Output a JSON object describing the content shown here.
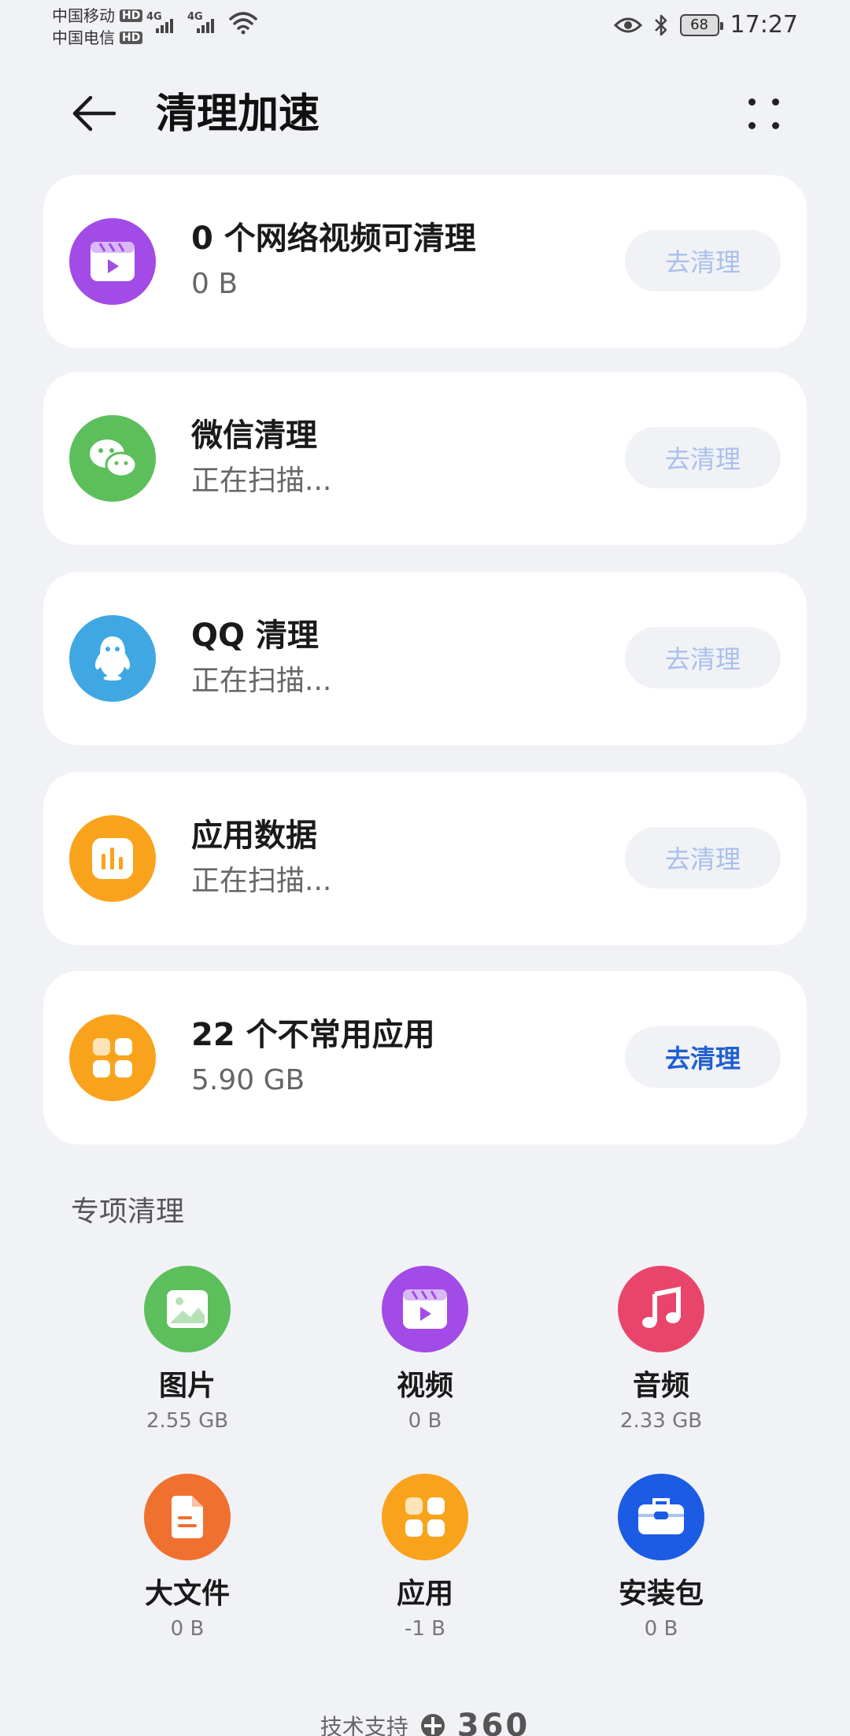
{
  "status_bar": {
    "carrier1": "中国移动",
    "carrier2": "中国电信",
    "hd": "HD",
    "net1": "4G",
    "net2": "4G",
    "battery": "68",
    "time": "17:27"
  },
  "header": {
    "title": "清理加速"
  },
  "cards": [
    {
      "title": "0 个网络视频可清理",
      "sub": "0 B",
      "button": "去清理",
      "icon": "video-icon",
      "color": "#a24be6"
    },
    {
      "title": "微信清理",
      "sub": "正在扫描...",
      "button": "去清理",
      "icon": "wechat-icon",
      "color": "#5cbf5c"
    },
    {
      "title": "QQ 清理",
      "sub": "正在扫描...",
      "button": "去清理",
      "icon": "qq-icon",
      "color": "#3fa8e3"
    },
    {
      "title": "应用数据",
      "sub": "正在扫描...",
      "button": "去清理",
      "icon": "app-data-icon",
      "color": "#f9a31d"
    },
    {
      "title": "22 个不常用应用",
      "sub": "5.90 GB",
      "button": "去清理",
      "icon": "apps-icon",
      "color": "#f9a31d"
    }
  ],
  "special": {
    "title": "专项清理",
    "items": [
      {
        "label": "图片",
        "size": "2.55 GB",
        "icon": "image-icon",
        "color": "#5cbf5c"
      },
      {
        "label": "视频",
        "size": "0 B",
        "icon": "video-icon",
        "color": "#a24be6"
      },
      {
        "label": "音频",
        "size": "2.33 GB",
        "icon": "music-icon",
        "color": "#e9456b"
      },
      {
        "label": "大文件",
        "size": "0 B",
        "icon": "file-icon",
        "color": "#f07030"
      },
      {
        "label": "应用",
        "size": "-1 B",
        "icon": "apps-icon",
        "color": "#f9a31d"
      },
      {
        "label": "安装包",
        "size": "0 B",
        "icon": "package-icon",
        "color": "#1c5be3"
      }
    ]
  },
  "footer": {
    "support_text": "技术支持",
    "brand": "360"
  }
}
